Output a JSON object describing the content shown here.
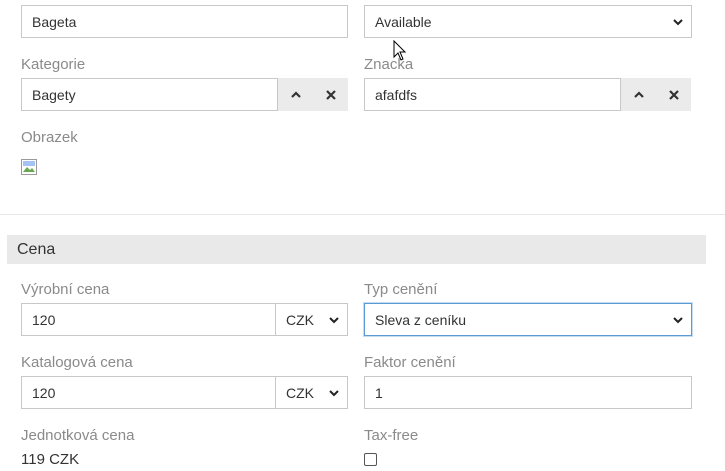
{
  "top": {
    "name_value": "Bageta",
    "availability_value": "Available"
  },
  "kategorie": {
    "label": "Kategorie",
    "value": "Bagety"
  },
  "znacka": {
    "label": "Znacka",
    "value": "afafdfs"
  },
  "obrazek": {
    "label": "Obrazek"
  },
  "cena": {
    "section_title": "Cena",
    "vyrobni_cena": {
      "label": "Výrobní cena",
      "value": "120",
      "currency": "CZK"
    },
    "typ_ceneni": {
      "label": "Typ cenění",
      "value": "Sleva z ceníku"
    },
    "katalogova_cena": {
      "label": "Katalogová cena",
      "value": "120",
      "currency": "CZK"
    },
    "faktor_ceneni": {
      "label": "Faktor cenění",
      "value": "1"
    },
    "jednotkova_cena": {
      "label": "Jednotková cena",
      "value": "119 CZK"
    },
    "tax_free": {
      "label": "Tax-free",
      "checked": false
    }
  },
  "icons": {
    "up": "chevron-up-icon",
    "remove": "close-icon",
    "dropdown": "chevron-down-icon",
    "image": "broken-image-icon",
    "cursor": "mouse-cursor-icon"
  },
  "colors": {
    "section_bg": "#e9e9e9",
    "focus_border": "#5b9bd5"
  }
}
